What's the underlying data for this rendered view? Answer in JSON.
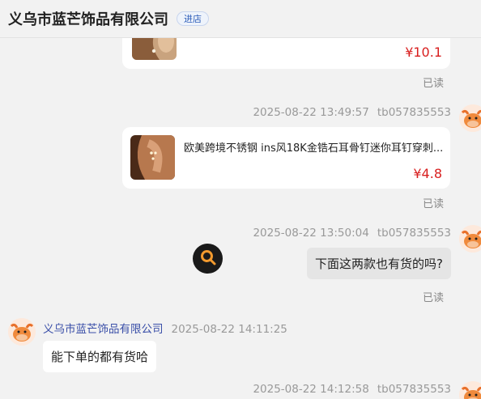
{
  "header": {
    "shop_name": "义乌市蓝芒饰品有限公司",
    "enter_label": "进店"
  },
  "messages": [
    {
      "type": "product",
      "side": "right",
      "price": "¥10.1",
      "read": "已读"
    },
    {
      "type": "product",
      "side": "right",
      "time": "2025-08-22 13:49:57",
      "sender": "tb057835553",
      "title": "欧美跨境不锈钢 ins风18K金锆石耳骨钉迷你耳钉穿刺...",
      "price": "¥4.8",
      "read": "已读"
    },
    {
      "type": "text",
      "side": "right",
      "time": "2025-08-22 13:50:04",
      "sender": "tb057835553",
      "text": "下面这两款也有货的吗?",
      "read": "已读"
    },
    {
      "type": "text",
      "side": "left",
      "sender": "义乌市蓝芒饰品有限公司",
      "time": "2025-08-22 14:11:25",
      "text": "能下单的都有货哈"
    },
    {
      "type": "text",
      "side": "right",
      "time": "2025-08-22 14:12:58",
      "sender": "tb057835553"
    }
  ],
  "icons": {
    "floating_search": "search-icon",
    "avatar": "cartoon-bull-avatar"
  },
  "colors": {
    "price": "#d81e1e",
    "shop_name_link": "#3a4fa8",
    "right_bubble": "#e5e5e5",
    "left_bubble": "#ffffff",
    "background": "#f2f2f2"
  }
}
